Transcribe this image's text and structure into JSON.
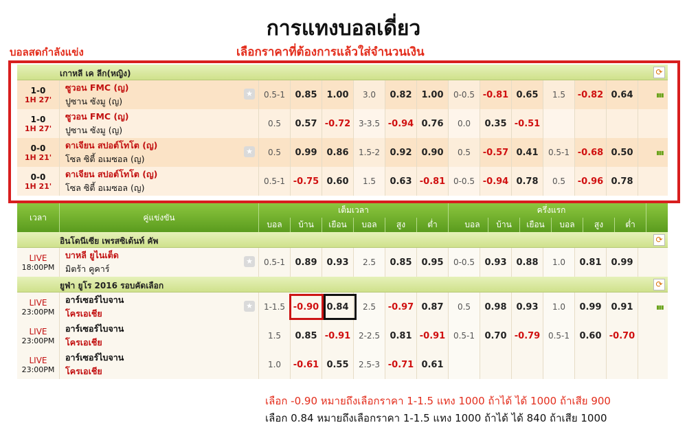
{
  "page_title": "การแทงบอลเดี่ยว",
  "live_label": "บอลสดกำลังแข่ง",
  "instruction": "เลือกราคาที่ต้องการแล้วใส่จำนวนเงิน",
  "live_section": {
    "league": "เกาหลี เค ลีก(หญิง)",
    "rows": [
      {
        "score": "1-0",
        "time": "1H 27'",
        "home": "ซูวอน FMC (ญ)",
        "away": "ปูซาน ซังมู (ญ)",
        "star": true,
        "cells": [
          "0.5-1",
          "0.85",
          "1.00",
          "3.0",
          "0.82",
          "1.00",
          "0-0.5",
          "-0.81",
          "0.65",
          "1.5",
          "-0.82",
          "0.64"
        ],
        "bars": true
      },
      {
        "score": "1-0",
        "time": "1H 27'",
        "home": "ซูวอน FMC (ญ)",
        "away": "ปูซาน ซังมู (ญ)",
        "star": false,
        "cells": [
          "0.5",
          "0.57",
          "-0.72",
          "3-3.5",
          "-0.94",
          "0.76",
          "0.0",
          "0.35",
          "-0.51",
          "",
          "",
          ""
        ],
        "bars": false
      },
      {
        "score": "0-0",
        "time": "1H 21'",
        "home": "ดาเจียน สปอต์โทโต (ญ)",
        "away": "โซล ซิตี้ อเมซอล (ญ)",
        "star": true,
        "cells": [
          "0.5",
          "0.99",
          "0.86",
          "1.5-2",
          "0.92",
          "0.90",
          "0.5",
          "-0.57",
          "0.41",
          "0.5-1",
          "-0.68",
          "0.50"
        ],
        "bars": true
      },
      {
        "score": "0-0",
        "time": "1H 21'",
        "home": "ดาเจียน สปอต์โทโต (ญ)",
        "away": "โซล ซิตี้ อเมซอล (ญ)",
        "star": false,
        "cells": [
          "0.5-1",
          "-0.75",
          "0.60",
          "1.5",
          "0.63",
          "-0.81",
          "0-0.5",
          "-0.94",
          "0.78",
          "0.5",
          "-0.96",
          "0.78"
        ],
        "bars": false
      }
    ]
  },
  "header": {
    "time": "เวลา",
    "match": "คู่แข่งขัน",
    "full_time": "เต็มเวลา",
    "first_half": "ครึ่งแรก",
    "sub": [
      "บอล",
      "บ้าน",
      "เยือน",
      "บอล",
      "สูง",
      "ต่ำ",
      "บอล",
      "บ้าน",
      "เยือน",
      "บอล",
      "สูง",
      "ต่ำ"
    ]
  },
  "leagues": [
    {
      "name": "อินโดนีเซีย เพรสซิเด้นท์ คัพ",
      "rows": [
        {
          "status": "LIVE",
          "time": "18:00PM",
          "home": "บาหลี ยูไนเต็ด",
          "away": "มิตร้า คูคาร์",
          "home_red": true,
          "away_red": false,
          "star": true,
          "cells": [
            "0.5-1",
            "0.89",
            "0.93",
            "2.5",
            "0.85",
            "0.95",
            "0-0.5",
            "0.93",
            "0.88",
            "1.0",
            "0.81",
            "0.99"
          ],
          "bars": false
        }
      ]
    },
    {
      "name": "ยูฟ่า ยูโร 2016 รอบคัดเลือก",
      "rows": [
        {
          "status": "LIVE",
          "time": "23:00PM",
          "home": "อาร์เซอร์ไบจาน",
          "away": "โครเอเชีย",
          "home_red": false,
          "away_red": true,
          "star": true,
          "cells": [
            "1-1.5",
            "-0.90",
            "0.84",
            "2.5",
            "-0.97",
            "0.87",
            "0.5",
            "0.98",
            "0.93",
            "1.0",
            "0.99",
            "0.91"
          ],
          "bars": true
        },
        {
          "status": "LIVE",
          "time": "23:00PM",
          "home": "อาร์เซอร์ไบจาน",
          "away": "โครเอเชีย",
          "home_red": false,
          "away_red": true,
          "star": false,
          "cells": [
            "1.5",
            "0.85",
            "-0.91",
            "2-2.5",
            "0.81",
            "-0.91",
            "0.5-1",
            "0.70",
            "-0.79",
            "0.5-1",
            "0.60",
            "-0.70"
          ],
          "bars": false
        },
        {
          "status": "LIVE",
          "time": "23:00PM",
          "home": "อาร์เซอร์ไบจาน",
          "away": "โครเอเชีย",
          "home_red": false,
          "away_red": true,
          "star": false,
          "cells": [
            "1.0",
            "-0.61",
            "0.55",
            "2.5-3",
            "-0.71",
            "0.61",
            "",
            "",
            "",
            "",
            "",
            ""
          ],
          "bars": false
        }
      ]
    }
  ],
  "notes": [
    "เลือก -0.90 หมายถึงเลือกราคา 1-1.5 แทง 1000 ถ้าได้ ได้ 1000 ถ้าเสีย 900",
    "เลือก 0.84 หมายถึงเลือกราคา 1-1.5 แทง 1000 ถ้าได้ ได้ 840 ถ้าเสีย 1000"
  ],
  "icons": {
    "refresh": "refresh-icon",
    "star": "star-icon",
    "stats": "stats-bars-icon"
  },
  "colors": {
    "accent_red": "#e32d1c",
    "header_green": "#6aa928",
    "league_green": "#dbeaa3",
    "live_row": "#fbe3c6",
    "live_row_alt": "#fdebd3"
  }
}
